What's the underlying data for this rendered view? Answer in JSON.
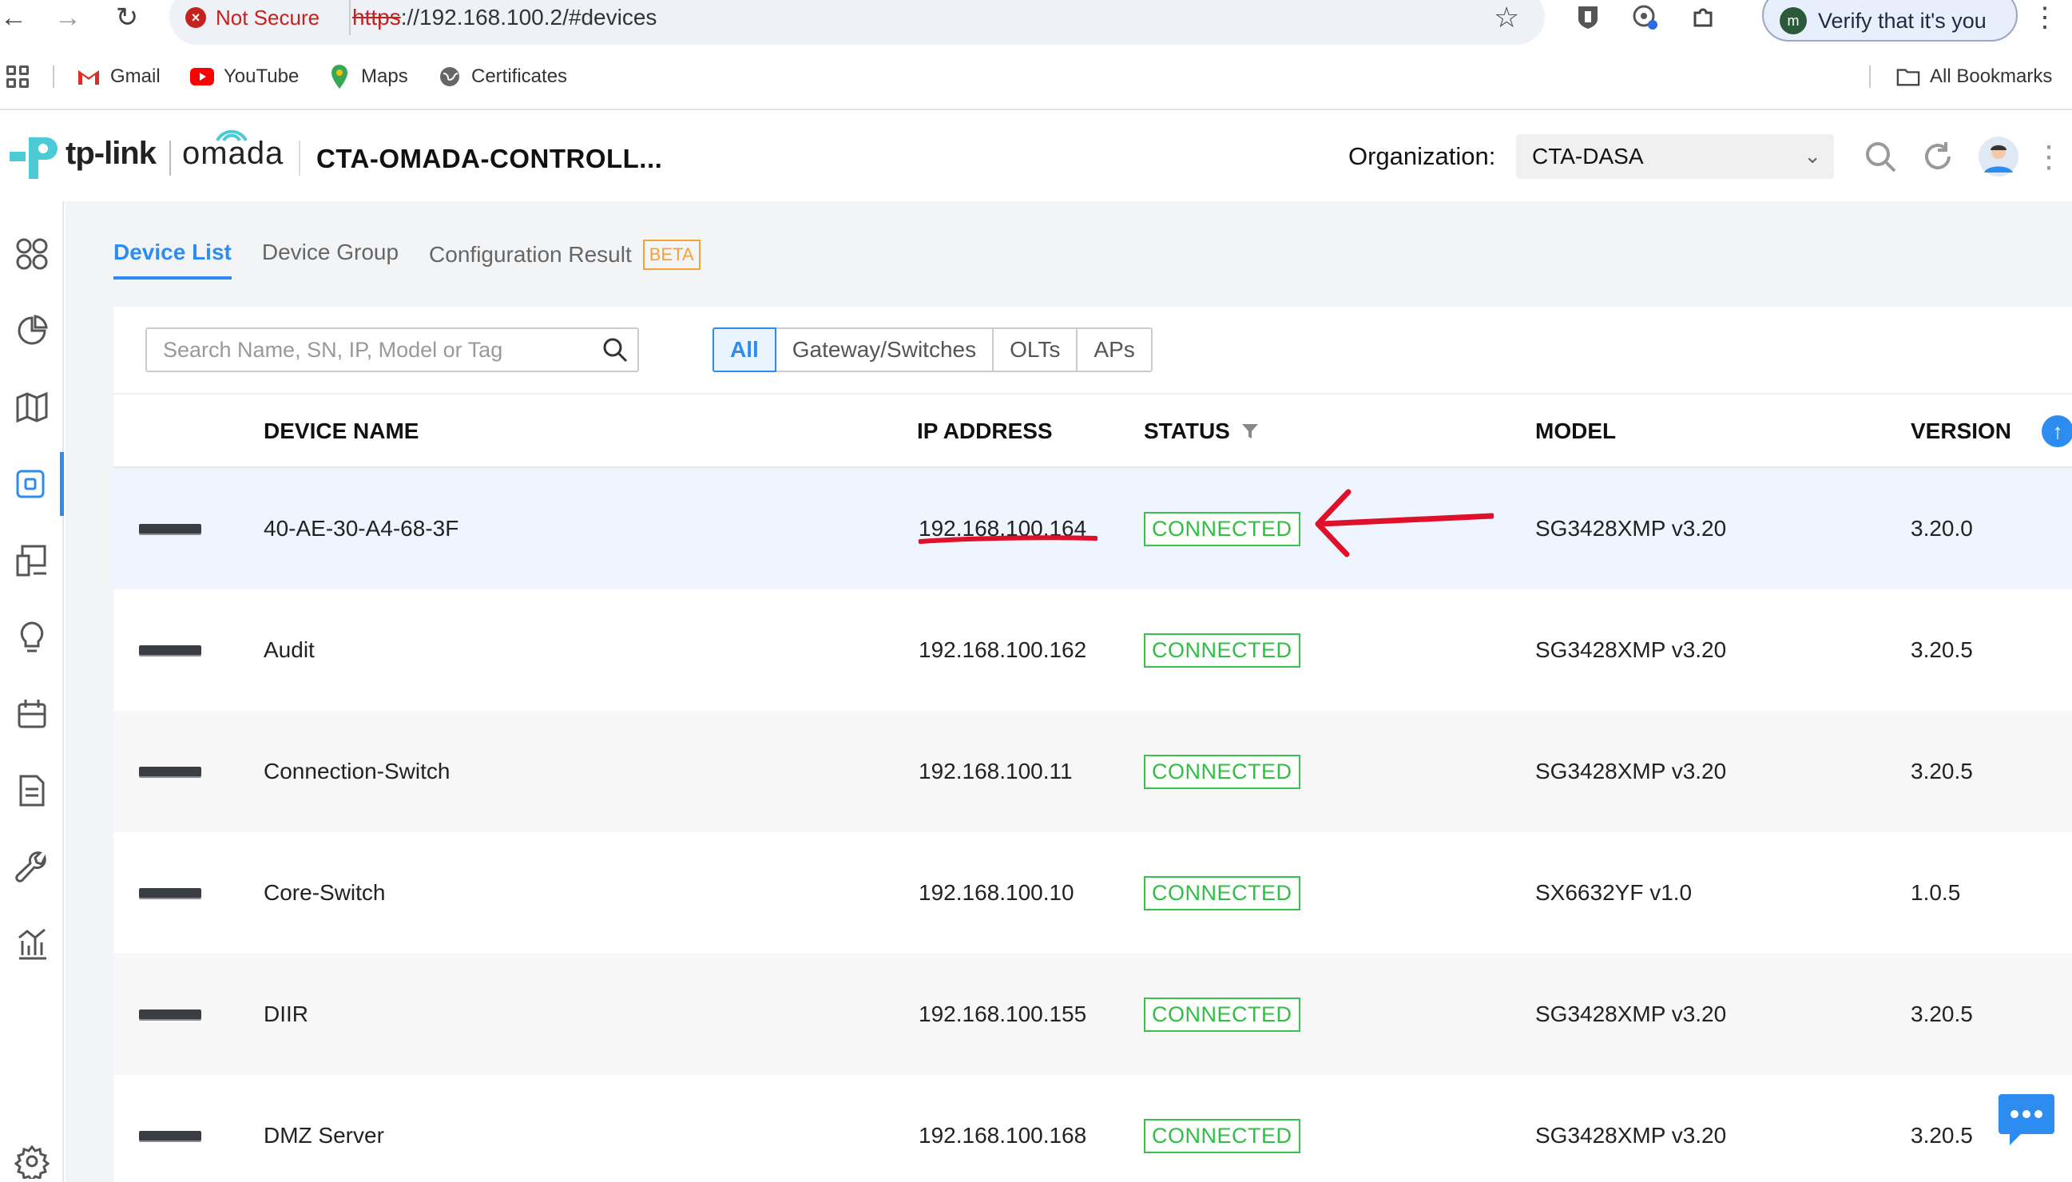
{
  "browser": {
    "security_label": "Not Secure",
    "url_protocol": "https",
    "url_rest": "://192.168.100.2/#devices",
    "verify_label": "Verify that it's you",
    "profile_initial": "m",
    "bookmarks": [
      "Gmail",
      "YouTube",
      "Maps",
      "Certificates"
    ],
    "all_bookmarks": "All Bookmarks"
  },
  "header": {
    "brand": "tp-link",
    "product": "omada",
    "controller_name": "CTA-OMADA-CONTROLL...",
    "org_label": "Organization:",
    "org_value": "CTA-DASA"
  },
  "tabs": {
    "device_list": "Device List",
    "device_group": "Device Group",
    "config_result": "Configuration Result",
    "beta": "BETA"
  },
  "search": {
    "placeholder": "Search Name, SN, IP, Model or Tag"
  },
  "filters": [
    "All",
    "Gateway/Switches",
    "OLTs",
    "APs"
  ],
  "table": {
    "columns": {
      "device_name": "DEVICE NAME",
      "ip_address": "IP ADDRESS",
      "status": "STATUS",
      "model": "MODEL",
      "version": "VERSION"
    },
    "rows": [
      {
        "name": "40-AE-30-A4-68-3F",
        "ip": "192.168.100.164",
        "status": "CONNECTED",
        "model": "SG3428XMP v3.20",
        "version": "3.20.0"
      },
      {
        "name": "Audit",
        "ip": "192.168.100.162",
        "status": "CONNECTED",
        "model": "SG3428XMP v3.20",
        "version": "3.20.5"
      },
      {
        "name": "Connection-Switch",
        "ip": "192.168.100.11",
        "status": "CONNECTED",
        "model": "SG3428XMP v3.20",
        "version": "3.20.5"
      },
      {
        "name": "Core-Switch",
        "ip": "192.168.100.10",
        "status": "CONNECTED",
        "model": "SX6632YF v1.0",
        "version": "1.0.5"
      },
      {
        "name": "DIIR",
        "ip": "192.168.100.155",
        "status": "CONNECTED",
        "model": "SG3428XMP v3.20",
        "version": "3.20.5"
      },
      {
        "name": "DMZ Server",
        "ip": "192.168.100.168",
        "status": "CONNECTED",
        "model": "SG3428XMP v3.20",
        "version": "3.20.5"
      }
    ]
  },
  "colors": {
    "accent": "#2d8cf0",
    "status_connected": "#2fbf45",
    "annotation_red": "#e0102a",
    "beta_orange": "#f5a13a"
  }
}
